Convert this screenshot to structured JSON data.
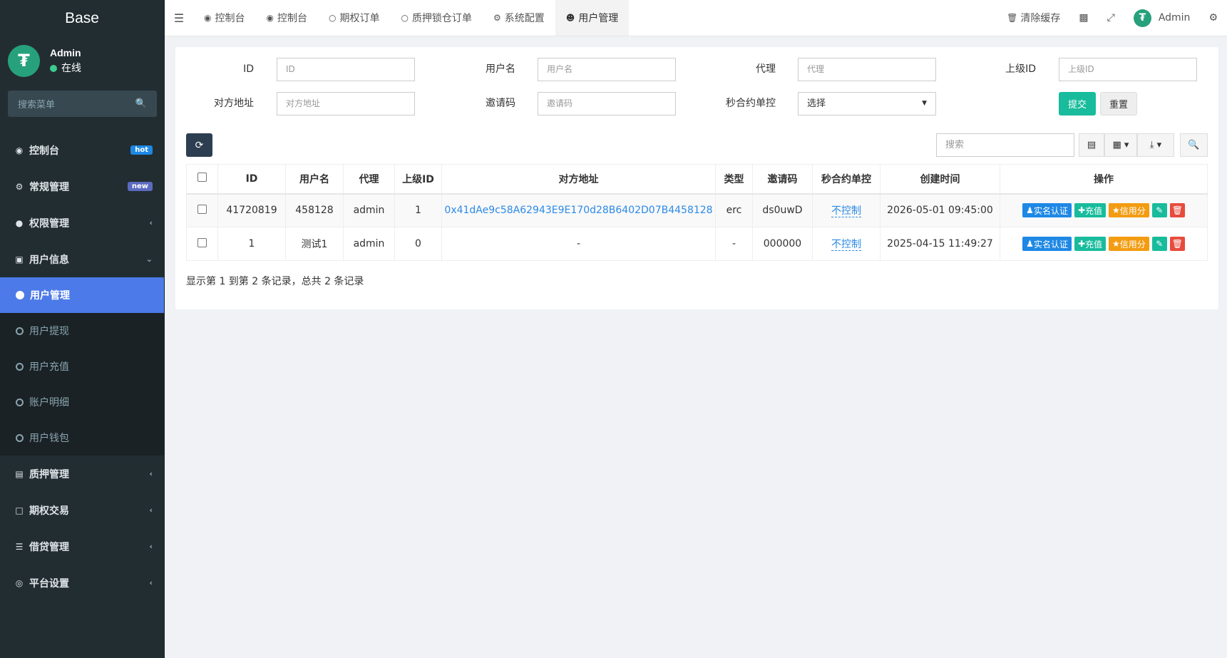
{
  "brand": "Base",
  "user": {
    "name": "Admin",
    "status": "在线"
  },
  "sidebar": {
    "search_placeholder": "搜索菜单",
    "items": [
      {
        "label": "控制台",
        "badge": "hot"
      },
      {
        "label": "常规管理",
        "badge": "new"
      },
      {
        "label": "权限管理"
      },
      {
        "label": "用户信息"
      }
    ],
    "sub_items": [
      "用户管理",
      "用户提现",
      "用户充值",
      "账户明细",
      "用户钱包"
    ],
    "bottom_items": [
      "质押管理",
      "期权交易",
      "借贷管理",
      "平台设置"
    ]
  },
  "topnav": {
    "tabs": [
      "控制台",
      "控制台",
      "期权订单",
      "质押锁仓订单",
      "系统配置",
      "用户管理"
    ],
    "clear_cache": "清除缓存",
    "admin": "Admin"
  },
  "filters": {
    "id_label": "ID",
    "id_placeholder": "ID",
    "username_label": "用户名",
    "username_placeholder": "用户名",
    "agent_label": "代理",
    "agent_placeholder": "代理",
    "parent_label": "上级ID",
    "parent_placeholder": "上级ID",
    "address_label": "对方地址",
    "address_placeholder": "对方地址",
    "invite_label": "邀请码",
    "invite_placeholder": "邀请码",
    "control_label": "秒合约单控",
    "control_value": "选择",
    "submit": "提交",
    "reset": "重置"
  },
  "toolbar": {
    "search_placeholder": "搜索"
  },
  "table": {
    "headers": [
      "ID",
      "用户名",
      "代理",
      "上级ID",
      "对方地址",
      "类型",
      "邀请码",
      "秒合约单控",
      "创建时间",
      "操作"
    ],
    "rows": [
      [
        "41720819",
        "458128",
        "admin",
        "1",
        "0x41dAe9c58A62943E9E170d28B6402D07B4458128",
        "erc",
        "ds0uwD",
        "不控制",
        "2026-05-01 09:45:00"
      ],
      [
        "1",
        "测试1",
        "admin",
        "0",
        "-",
        "-",
        "000000",
        "不控制",
        "2025-04-15 11:49:27"
      ]
    ],
    "ops": {
      "verify": "实名认证",
      "recharge": "充值",
      "credit": "信用分"
    }
  },
  "summary": "显示第 1 到第 2 条记录，总共 2 条记录"
}
